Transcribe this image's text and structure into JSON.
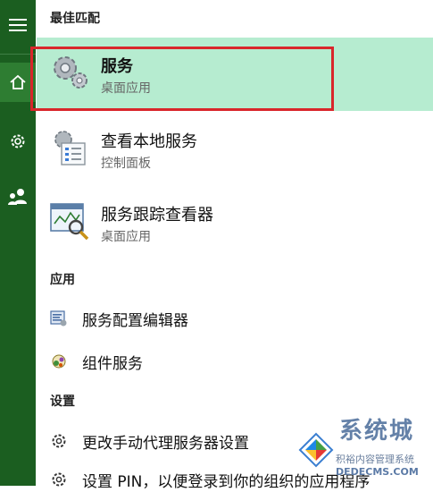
{
  "header": {
    "title": "最佳匹配"
  },
  "best_match": {
    "title": "服务",
    "subtitle": "桌面应用",
    "icon": "services-gear-icon"
  },
  "results": [
    {
      "title": "查看本地服务",
      "subtitle": "控制面板",
      "icon": "local-services-icon"
    },
    {
      "title": "服务跟踪查看器",
      "subtitle": "桌面应用",
      "icon": "trace-viewer-icon"
    }
  ],
  "apps": {
    "label": "应用",
    "items": [
      {
        "label": "服务配置编辑器",
        "icon": "config-editor-icon"
      },
      {
        "label": "组件服务",
        "icon": "component-services-icon"
      }
    ]
  },
  "settings": {
    "label": "设置",
    "items": [
      {
        "label": "更改手动代理服务器设置",
        "icon": "gear-icon"
      },
      {
        "label": "设置 PIN，以便登录到你的组织的应用程序",
        "icon": "gear-icon"
      }
    ]
  },
  "watermark": {
    "title": "系统城",
    "line1": "积裕内容管理系统",
    "line2": "DEDECMS.COM"
  },
  "colors": {
    "rail": "#1b5e20",
    "highlight": "#b6ecd0",
    "outline": "#d9262b"
  }
}
